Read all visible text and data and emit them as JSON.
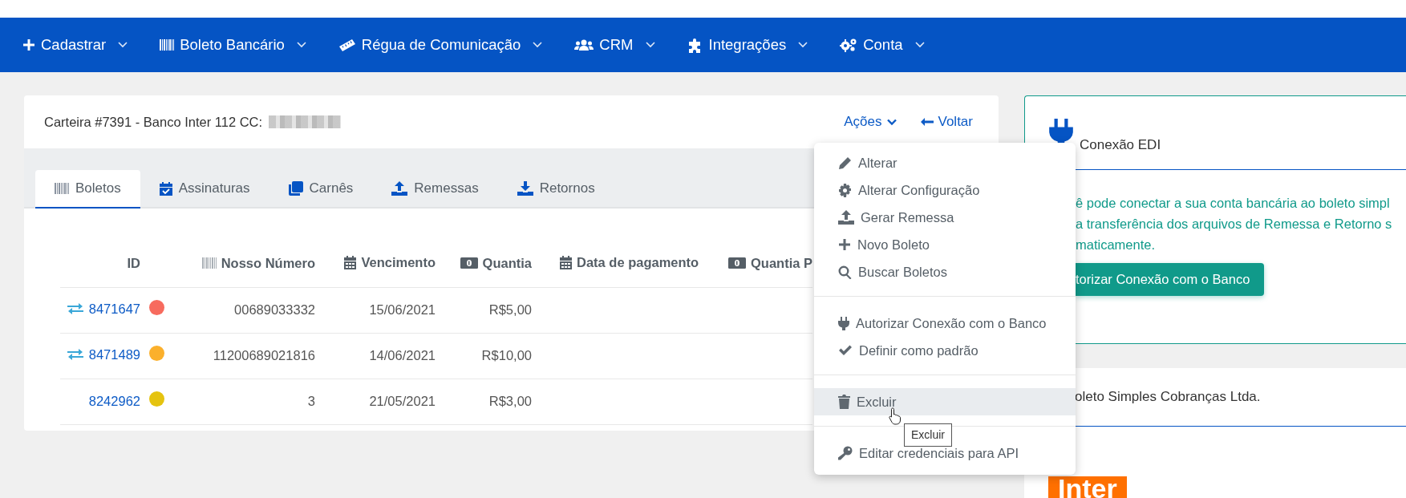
{
  "nav": [
    {
      "label": "Cadastrar"
    },
    {
      "label": "Boleto Bancário"
    },
    {
      "label": "Régua de Comunicação"
    },
    {
      "label": "CRM"
    },
    {
      "label": "Integrações"
    },
    {
      "label": "Conta"
    }
  ],
  "wallet": {
    "title": "Carteira #7391 - Banco Inter 112 CC:",
    "actions_link": "Ações",
    "back_link": "Voltar"
  },
  "tabs": [
    {
      "label": "Boletos",
      "selected": true
    },
    {
      "label": "Assinaturas",
      "selected": false
    },
    {
      "label": "Carnês",
      "selected": false
    },
    {
      "label": "Remessas",
      "selected": false
    },
    {
      "label": "Retornos",
      "selected": false
    }
  ],
  "table": {
    "columns": [
      {
        "label": "ID"
      },
      {
        "label": "Nosso Número"
      },
      {
        "label": "Vencimento"
      },
      {
        "label": "Quantia"
      },
      {
        "label": "Data de pagamento"
      },
      {
        "label": "Quantia P"
      }
    ],
    "rows": [
      {
        "id": "8471647",
        "synced": true,
        "color": "#f76b5e",
        "nosso_numero": "00689033332",
        "vencimento": "15/06/2021",
        "quantia": "R$5,00"
      },
      {
        "id": "8471489",
        "synced": true,
        "color": "#fbb02c",
        "nosso_numero": "11200689021816",
        "vencimento": "14/06/2021",
        "quantia": "R$10,00"
      },
      {
        "id": "8242962",
        "synced": false,
        "color": "#e5c30f",
        "nosso_numero": "3",
        "vencimento": "21/05/2021",
        "quantia": "R$3,00"
      }
    ]
  },
  "action_menu": {
    "groups": [
      [
        {
          "label": "Alterar",
          "hovered": false
        },
        {
          "label": "Alterar Configuração",
          "hovered": false
        },
        {
          "label": "Gerar Remessa",
          "hovered": false
        },
        {
          "label": "Novo Boleto",
          "hovered": false
        },
        {
          "label": "Buscar Boletos",
          "hovered": false
        }
      ],
      [
        {
          "label": "Autorizar Conexão com o Banco",
          "hovered": false
        },
        {
          "label": "Definir como padrão",
          "hovered": false
        }
      ],
      [
        {
          "label": "Excluir",
          "hovered": true
        }
      ],
      [
        {
          "label": "Editar credenciais para API",
          "hovered": false
        }
      ]
    ],
    "tooltip": "Excluir"
  },
  "edi_panel": {
    "title": "Conexão EDI",
    "text_lines": [
      "ê pode conectar a sua conta bancária ao boleto simpl",
      "a transferência dos arquivos de Remessa e Retorno s",
      "maticamente."
    ],
    "button": "torizar Conexão com o Banco"
  },
  "company_panel": {
    "title": "oleto Simples Cobranças Ltda.",
    "logo": "Inter"
  }
}
